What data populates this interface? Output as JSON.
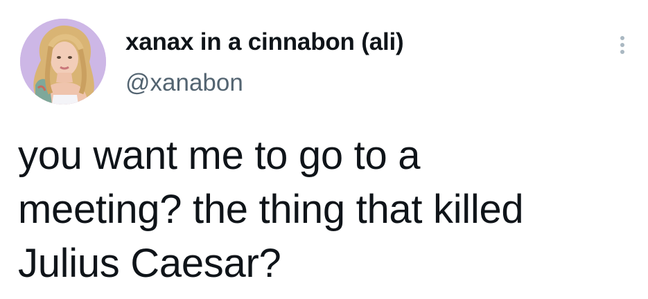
{
  "tweet": {
    "author": {
      "display_name": "xanax in a cinnabon (ali)",
      "handle": "@xanabon",
      "avatar_icon": "profile-photo"
    },
    "more_icon": "more-options-vertical-dots-icon",
    "text_lines": [
      "you want me to go to a",
      "meeting? the thing that killed",
      "Julius Caesar?"
    ]
  },
  "colors": {
    "text_primary": "#0f1419",
    "text_secondary": "#536471",
    "avatar_background": "#cdb7e6",
    "more_icon": "#aab8c2"
  }
}
